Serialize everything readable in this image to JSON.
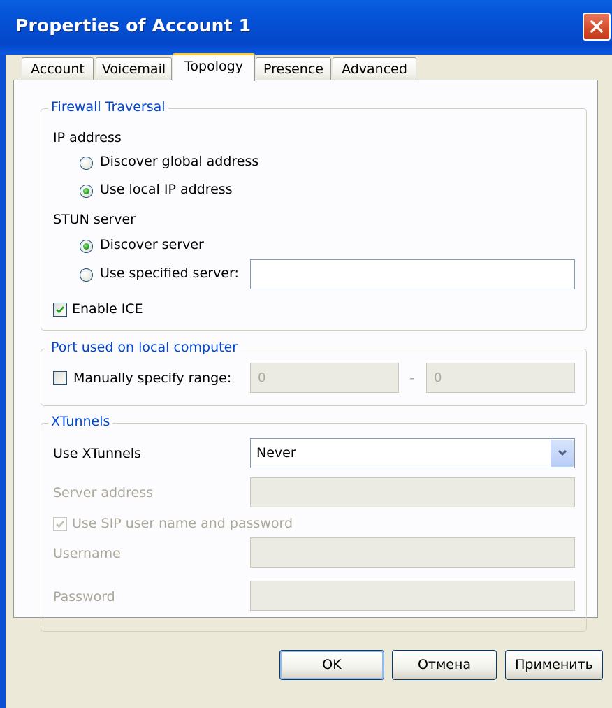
{
  "window": {
    "title": "Properties of Account 1"
  },
  "tabs": [
    "Account",
    "Voicemail",
    "Topology",
    "Presence",
    "Advanced"
  ],
  "firewall": {
    "legend": "Firewall Traversal",
    "ip_address_label": "IP address",
    "ip_options": [
      "Discover global address",
      "Use local IP address"
    ],
    "ip_selected": "Use local IP address",
    "stun_label": "STUN server",
    "stun_options": [
      "Discover server",
      "Use specified server:"
    ],
    "stun_selected": "Discover server",
    "stun_server_value": "",
    "enable_ice_label": "Enable ICE",
    "enable_ice_checked": true
  },
  "port": {
    "legend": "Port used on local computer",
    "manual_label": "Manually specify range:",
    "manual_checked": false,
    "range_from": "0",
    "range_sep": "-",
    "range_to": "0"
  },
  "xtunnels": {
    "legend": "XTunnels",
    "use_label": "Use XTunnels",
    "use_value": "Never",
    "server_address_label": "Server address",
    "server_address_value": "",
    "use_sip_label": "Use SIP user name and password",
    "use_sip_checked": true,
    "username_label": "Username",
    "username_value": "",
    "password_label": "Password",
    "password_value": ""
  },
  "buttons": {
    "ok": "OK",
    "cancel": "Отмена",
    "apply": "Применить"
  },
  "icons": {
    "close": "close-icon",
    "dropdown": "chevron-down-icon",
    "check": "checkmark-icon"
  },
  "colors": {
    "titlebar": "#0553d8",
    "accent_tab": "#ffc83c",
    "group_label": "#0046d5",
    "radio_on": "#21a121"
  }
}
